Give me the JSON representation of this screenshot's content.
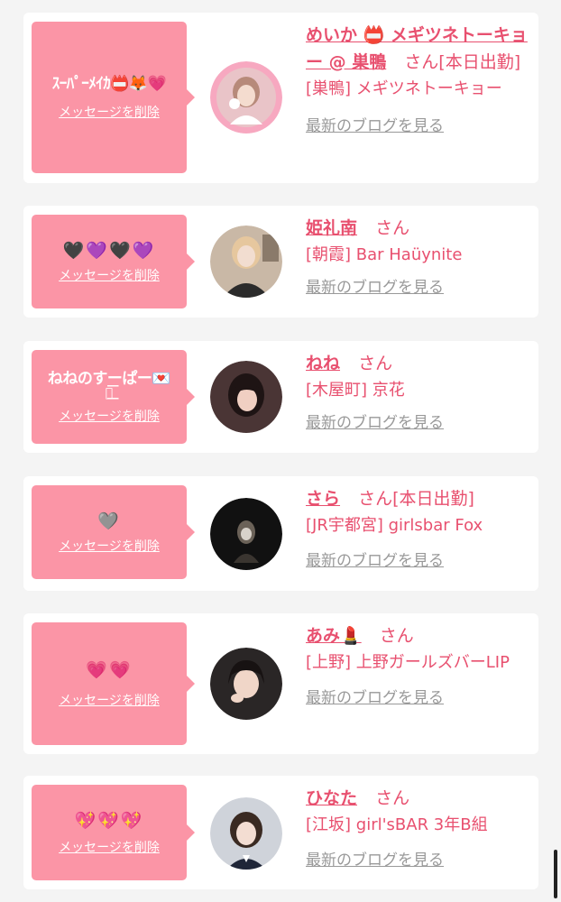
{
  "colors": {
    "accent": "#e8506f",
    "bubble": "#fb95a6",
    "card": "#ffffff",
    "background": "#f4f4f4",
    "muted": "#999999"
  },
  "delete_label": "メッセージを削除",
  "blog_label": "最新のブログを見る",
  "honorific": "さん",
  "cards": [
    {
      "message": "ｽｰﾊﾟｰﾒｲｶ📛🦊💗",
      "name": "めいか 📛 メギツネトーキョー @ 巣鴨",
      "san_suffix": "さん[本日出勤]",
      "shop": "[巣鴨] メギツネトーキョー"
    },
    {
      "message": "🖤💜🖤💜",
      "name": "姫礼南",
      "san_suffix": "さん",
      "shop": "[朝霞] Bar Haüynite"
    },
    {
      "message": "ねねのすーぱー💌",
      "message_2": "ｰ͟͟͞͞",
      "name": "ねね",
      "san_suffix": "さん",
      "shop": "[木屋町] 京花"
    },
    {
      "message": "🩶",
      "name": "さら",
      "san_suffix": "さん[本日出勤]",
      "shop": "[JR宇都宮] girlsbar Fox"
    },
    {
      "message": "💗💗",
      "name": "あみ💄",
      "san_suffix": "さん",
      "shop": "[上野] 上野ガールズバーLIP"
    },
    {
      "message": "💖💖💖",
      "name": "ひなた",
      "san_suffix": "さん",
      "shop": "[江坂] girl'sBAR 3年B組"
    }
  ]
}
